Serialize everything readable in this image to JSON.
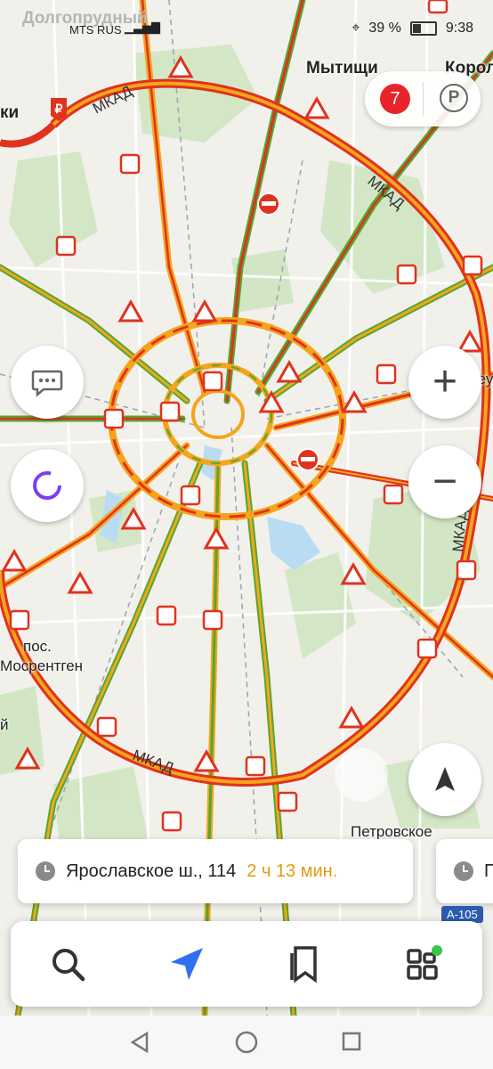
{
  "status_bar": {
    "ghost_city": "Долгопрудный",
    "carrier": "MTS RUS",
    "battery": "39 %",
    "time": "9:38"
  },
  "map": {
    "labels": {
      "mytishchi": "Мытищи",
      "korolev": "Корол",
      "lyubertsy_partial": "Реут",
      "ki": "ки",
      "pos": "пос.",
      "mosrentgen": "Мосрентген",
      "petrovskoe": "Петровское",
      "y": "й"
    },
    "road_labels": {
      "mkad_nw": "МКАД",
      "mkad_ne": "МКАД",
      "mkad_e": "МКАД",
      "mkad_s": "МКАД"
    },
    "traffic_colors": {
      "heavy": "#e0321e",
      "medium": "#f3a51c",
      "free": "#52a832"
    },
    "highway_badge": "А-105"
  },
  "top_controls": {
    "traffic_score": "7",
    "parking_label": "P"
  },
  "side_controls": {
    "chat_icon": "chat-bubble-icon",
    "alice_icon": "alice-assistant-icon",
    "zoom_in": "+",
    "zoom_out": "−"
  },
  "route_card": {
    "destination": "Ярославское ш., 114",
    "duration": "2 ч 13 мин.",
    "second_partial": "П"
  },
  "bottom_bar": {
    "items": [
      "search-icon",
      "navigator-icon",
      "bookmarks-icon",
      "services-icon"
    ]
  }
}
